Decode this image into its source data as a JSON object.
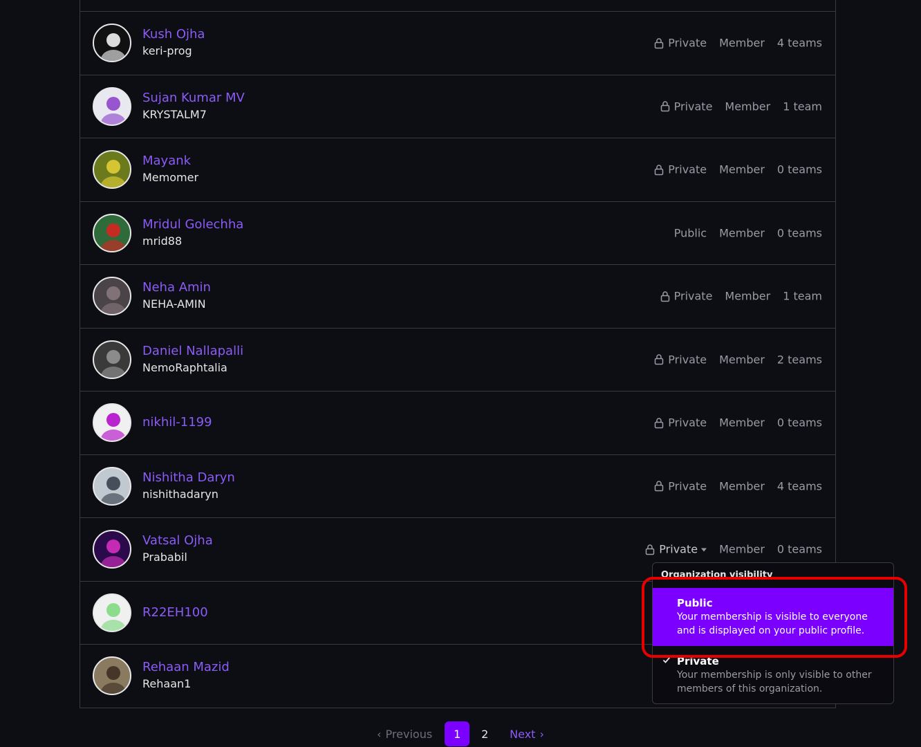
{
  "members": [
    {
      "name": "Kush Ojha",
      "login": "keri-prog",
      "visibility": "Private",
      "private": true,
      "role": "Member",
      "teams": "4 teams",
      "avatar_bg": "#111111",
      "avatar_fg": "#ffffff"
    },
    {
      "name": "Sujan Kumar MV",
      "login": "KRYSTALM7",
      "visibility": "Private",
      "private": true,
      "role": "Member",
      "teams": "1 team",
      "avatar_bg": "#e8e8f0",
      "avatar_fg": "#8a3cc8"
    },
    {
      "name": "Mayank",
      "login": "Memomer",
      "visibility": "Private",
      "private": true,
      "role": "Member",
      "teams": "0 teams",
      "avatar_bg": "#6b7a1c",
      "avatar_fg": "#e8d23a"
    },
    {
      "name": "Mridul Golechha",
      "login": "mrid88",
      "visibility": "Public",
      "private": false,
      "role": "Member",
      "teams": "0 teams",
      "avatar_bg": "#2f6b3a",
      "avatar_fg": "#e02020"
    },
    {
      "name": "Neha Amin",
      "login": "NEHA-AMIN",
      "visibility": "Private",
      "private": true,
      "role": "Member",
      "teams": "1 team",
      "avatar_bg": "#4a4448",
      "avatar_fg": "#8a7a80"
    },
    {
      "name": "Daniel Nallapalli",
      "login": "NemoRaphtalia",
      "visibility": "Private",
      "private": true,
      "role": "Member",
      "teams": "2 teams",
      "avatar_bg": "#3a3a3a",
      "avatar_fg": "#9a9a9a"
    },
    {
      "name": "nikhil-1199",
      "login": "",
      "visibility": "Private",
      "private": true,
      "role": "Member",
      "teams": "0 teams",
      "avatar_bg": "#f0f0f0",
      "avatar_fg": "#b000c8"
    },
    {
      "name": "Nishitha Daryn",
      "login": "nishithadaryn",
      "visibility": "Private",
      "private": true,
      "role": "Member",
      "teams": "4 teams",
      "avatar_bg": "#c0c8d0",
      "avatar_fg": "#303848"
    },
    {
      "name": "Vatsal Ojha",
      "login": "Prababil",
      "visibility": "Private",
      "private": true,
      "role": "Member",
      "teams": "0 teams",
      "avatar_bg": "#2a0a4a",
      "avatar_fg": "#e030c8",
      "dropdown_open": true
    },
    {
      "name": "R22EH100",
      "login": "",
      "visibility": "",
      "private": false,
      "role": "",
      "teams": "",
      "avatar_bg": "#f0f0f0",
      "avatar_fg": "#7ad87a"
    },
    {
      "name": "Rehaan Mazid",
      "login": "Rehaan1",
      "visibility": "",
      "private": false,
      "role": "",
      "teams": "",
      "avatar_bg": "#8a7a60",
      "avatar_fg": "#3a2a20"
    }
  ],
  "dropdown": {
    "title": "Organization visibility",
    "options": [
      {
        "title": "Public",
        "desc": "Your membership is visible to everyone and is displayed on your public profile."
      },
      {
        "title": "Private",
        "desc": "Your membership is only visible to other members of this organization."
      }
    ]
  },
  "pagination": {
    "previous": "Previous",
    "pages": [
      "1",
      "2"
    ],
    "current": "1",
    "next": "Next"
  },
  "colors": {
    "accent": "#7c00ff",
    "link": "#8b5cf6",
    "highlight": "#e60000"
  }
}
